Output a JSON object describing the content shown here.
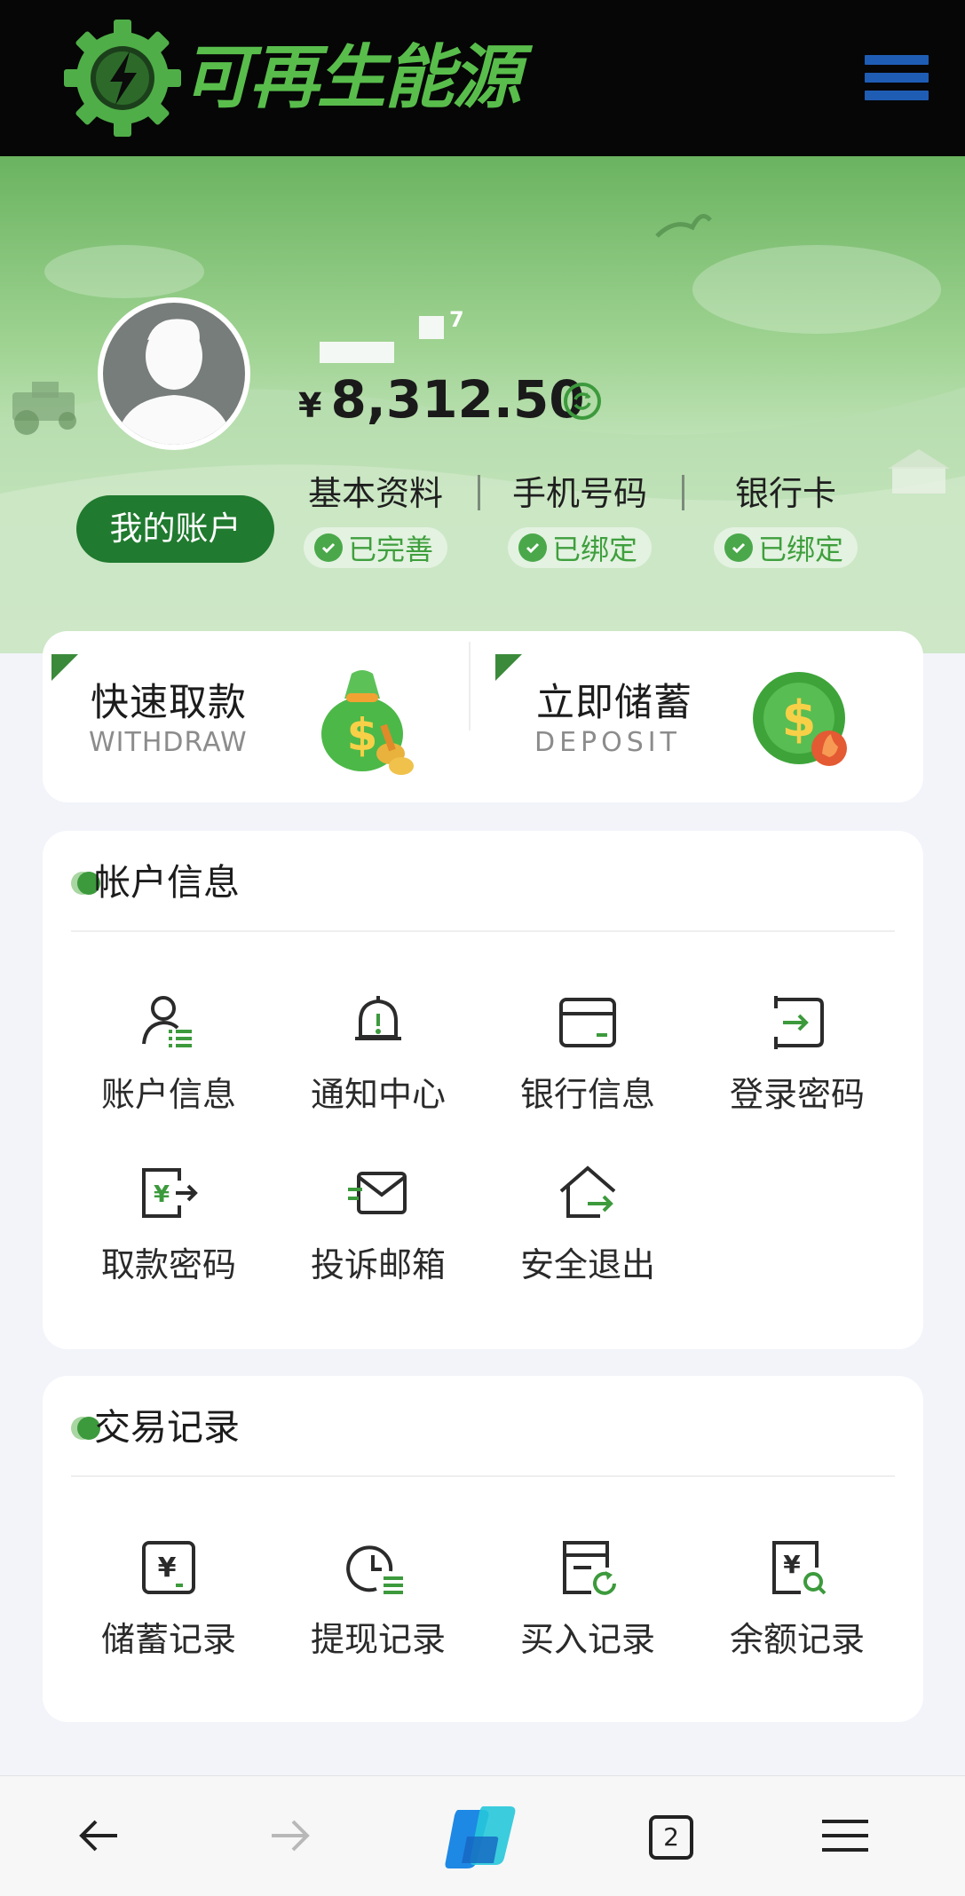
{
  "header": {
    "brand": "可再生能源",
    "menu_icon": "hamburger-menu-icon",
    "brand_color": "#59bd4c",
    "menu_color": "#1f5db5"
  },
  "profile": {
    "account_button": "我的账户",
    "username_superscript": "7",
    "currency": "¥",
    "balance": "8,312.50",
    "refresh_icon": "refresh-icon",
    "statuses": [
      {
        "label": "基本资料",
        "badge": "已完善"
      },
      {
        "label": "手机号码",
        "badge": "已绑定"
      },
      {
        "label": "银行卡",
        "badge": "已绑定"
      }
    ]
  },
  "quick": {
    "withdraw": {
      "title": "快速取款",
      "subtitle": "WITHDRAW",
      "icon": "money-bag-icon"
    },
    "deposit": {
      "title": "立即储蓄",
      "subtitle": "DEPOSIT",
      "icon": "dollar-coin-icon"
    }
  },
  "account_info": {
    "title": "帐户信息",
    "items": [
      {
        "label": "账户信息",
        "icon": "user-list-icon"
      },
      {
        "label": "通知中心",
        "icon": "bell-icon"
      },
      {
        "label": "银行信息",
        "icon": "card-icon"
      },
      {
        "label": "登录密码",
        "icon": "login-icon"
      },
      {
        "label": "取款密码",
        "icon": "yuan-arrow-icon"
      },
      {
        "label": "投诉邮箱",
        "icon": "mail-icon"
      },
      {
        "label": "安全退出",
        "icon": "home-exit-icon"
      }
    ]
  },
  "transactions": {
    "title": "交易记录",
    "items": [
      {
        "label": "储蓄记录",
        "icon": "yuan-doc-icon"
      },
      {
        "label": "提现记录",
        "icon": "clock-list-icon"
      },
      {
        "label": "买入记录",
        "icon": "doc-refresh-icon"
      },
      {
        "label": "余额记录",
        "icon": "yuan-search-icon"
      }
    ]
  },
  "browser": {
    "back_icon": "back-arrow-icon",
    "forward_icon": "forward-arrow-icon",
    "assistant_icon": "copilot-icon",
    "tab_count": "2",
    "menu_icon": "browser-menu-icon"
  },
  "colors": {
    "accent_green": "#3c9a3c",
    "dark_green": "#207a2f",
    "header_bg": "#060606"
  }
}
